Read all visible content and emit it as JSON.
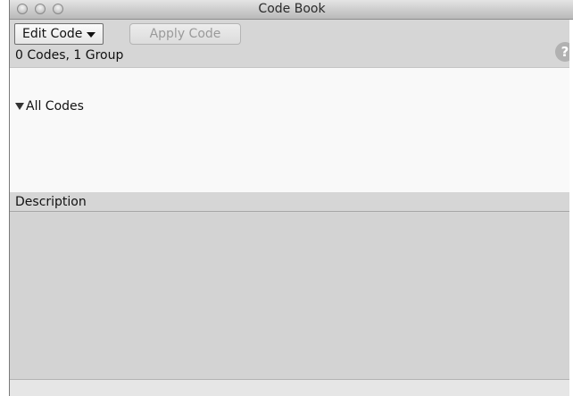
{
  "window": {
    "title": "Code Book"
  },
  "toolbar": {
    "edit_code_label": "Edit Code",
    "apply_code_label": "Apply Code",
    "help_label": "?"
  },
  "status": {
    "count_text": "0 Codes, 1 Group"
  },
  "code_tree": {
    "root_label": "All Codes",
    "expanded": true
  },
  "description": {
    "header": "Description",
    "text": ""
  },
  "colors": {
    "window_bg": "#d6d6d6",
    "list_bg": "#f9f9f9",
    "disabled_text": "#9a9a9a",
    "help_bg": "#b1b1b1"
  },
  "icons": {
    "edit_code_caret": "chevron-down-icon",
    "tree_disclosure": "triangle-down-icon",
    "help": "help-icon"
  }
}
